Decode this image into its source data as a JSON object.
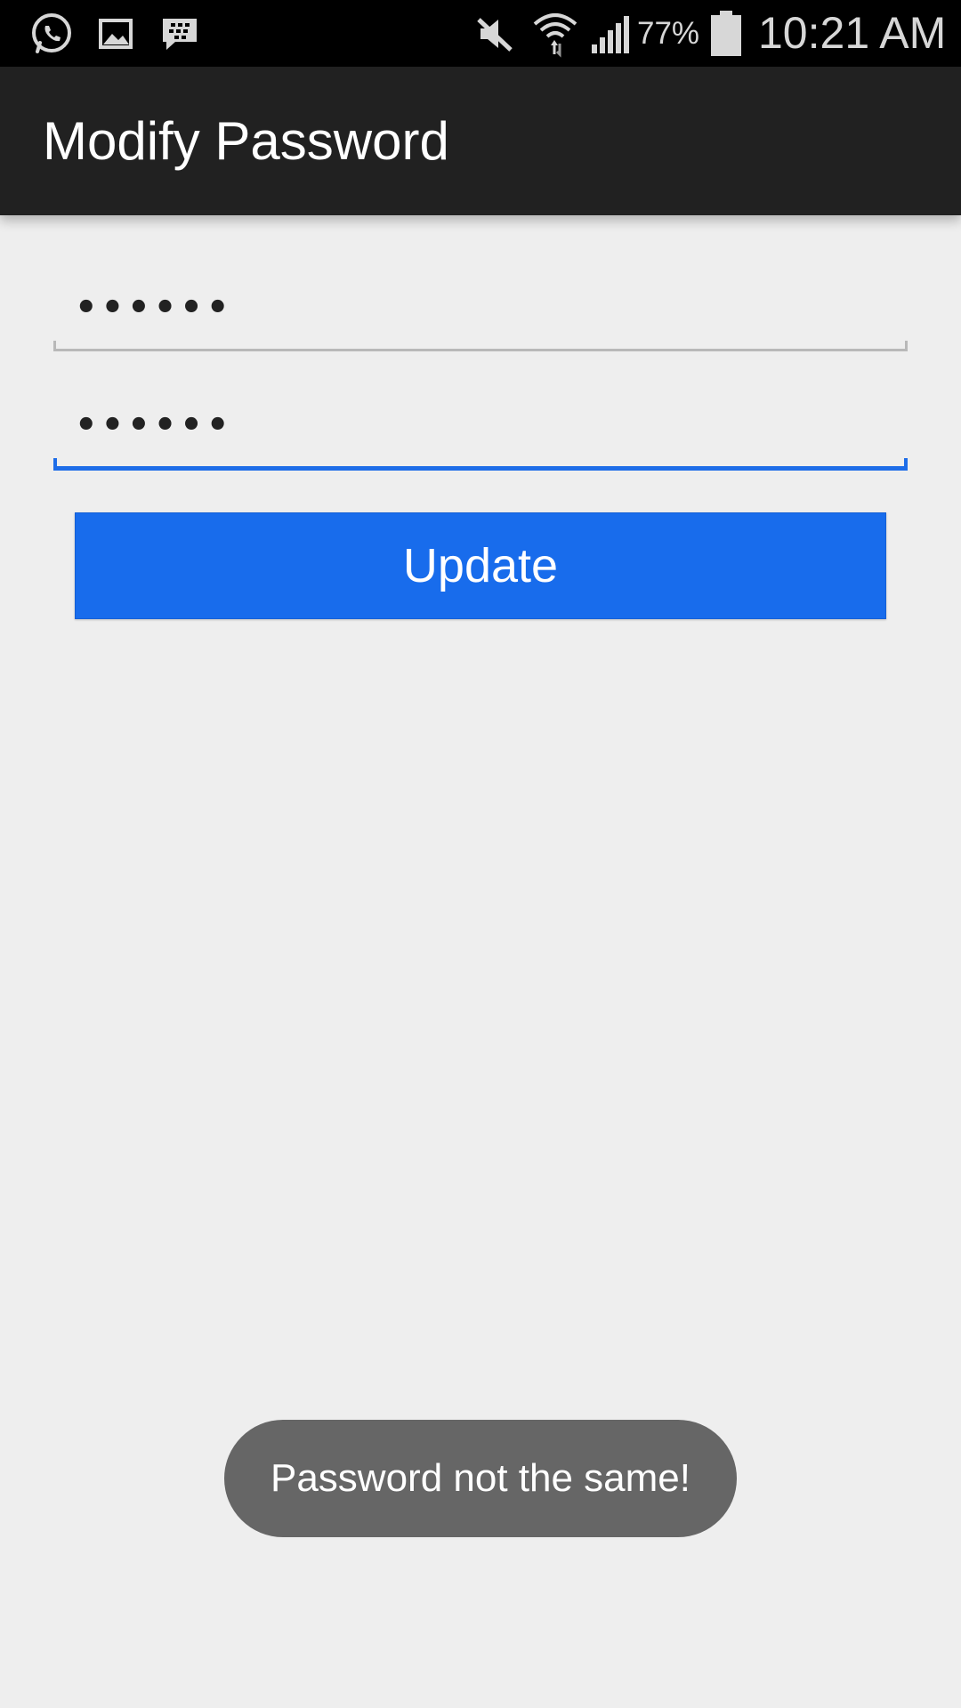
{
  "status_bar": {
    "icons_left": [
      "whatsapp-icon",
      "gallery-icon",
      "bbm-icon"
    ],
    "icons_right": [
      "mute-icon",
      "wifi-icon",
      "signal-icon",
      "battery-icon"
    ],
    "battery_percent": "77%",
    "battery_level": 0.77,
    "time": "10:21 AM"
  },
  "action_bar": {
    "title": "Modify Password"
  },
  "form": {
    "password_value": "••••••",
    "confirm_password_value": "••••••",
    "update_label": "Update"
  },
  "toast": {
    "message": "Password not the same!"
  },
  "colors": {
    "status_bar": "#000000",
    "action_bar": "#212121",
    "background": "#eeeeee",
    "accent": "#186cec",
    "toast": "#666666"
  }
}
